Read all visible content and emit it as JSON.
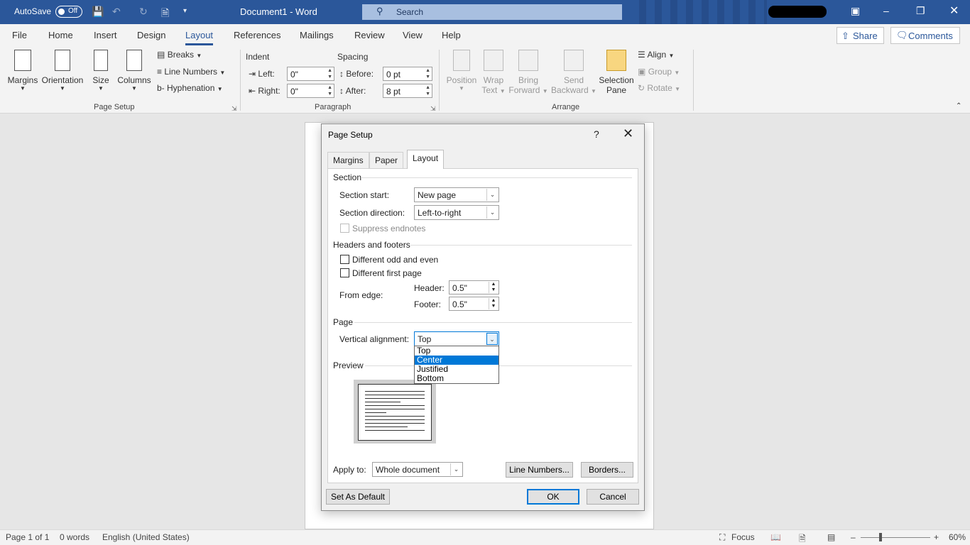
{
  "titlebar": {
    "autosave_label": "AutoSave",
    "autosave_state": "Off",
    "document_title": "Document1  -  Word",
    "search_placeholder": "Search",
    "save_icon": "save-icon",
    "undo_icon": "undo-icon",
    "redo_icon": "redo-icon"
  },
  "ribbon_tabs": {
    "file": "File",
    "home": "Home",
    "insert": "Insert",
    "design": "Design",
    "layout": "Layout",
    "references": "References",
    "mailings": "Mailings",
    "review": "Review",
    "view": "View",
    "help": "Help",
    "share": "Share",
    "comments": "Comments"
  },
  "ribbon": {
    "margins": "Margins",
    "orientation": "Orientation",
    "size": "Size",
    "columns": "Columns",
    "breaks": "Breaks",
    "line_numbers": "Line Numbers",
    "hyphenation": "Hyphenation",
    "page_setup_group": "Page Setup",
    "indent": "Indent",
    "spacing": "Spacing",
    "left_label": "Left:",
    "left_value": "0\"",
    "right_label": "Right:",
    "right_value": "0\"",
    "before_label": "Before:",
    "before_value": "0 pt",
    "after_label": "After:",
    "after_value": "8 pt",
    "paragraph_group": "Paragraph",
    "position_1": "Position",
    "wrap_1": "Wrap",
    "wrap_2": "Text",
    "bring_1": "Bring",
    "bring_2": "Forward",
    "send_1": "Send",
    "send_2": "Backward",
    "selection_1": "Selection",
    "selection_2": "Pane",
    "align": "Align",
    "group": "Group",
    "rotate": "Rotate",
    "arrange_group": "Arrange"
  },
  "dialog": {
    "title": "Page Setup",
    "help": "?",
    "tabs": [
      "Margins",
      "Paper",
      "Layout"
    ],
    "section_heading": "Section",
    "section_start_label": "Section start:",
    "section_start_value": "New page",
    "section_direction_label": "Section direction:",
    "section_direction_value": "Left-to-right",
    "suppress_endnotes": "Suppress endnotes",
    "headers_footers_heading": "Headers and footers",
    "different_odd_even": "Different odd and even",
    "different_first_page": "Different first page",
    "from_edge": "From edge:",
    "header_label": "Header:",
    "header_value": "0.5\"",
    "footer_label": "Footer:",
    "footer_value": "0.5\"",
    "page_heading": "Page",
    "vertical_alignment_label": "Vertical alignment:",
    "vertical_alignment_value": "Top",
    "vertical_alignment_options": [
      "Top",
      "Center",
      "Justified",
      "Bottom"
    ],
    "preview_heading": "Preview",
    "apply_to_label": "Apply to:",
    "apply_to_value": "Whole document",
    "line_numbers_button": "Line Numbers...",
    "borders_button": "Borders...",
    "set_default_button": "Set As Default",
    "ok_button": "OK",
    "cancel_button": "Cancel"
  },
  "statusbar": {
    "page": "Page 1 of 1",
    "words": "0 words",
    "language": "English (United States)",
    "focus": "Focus",
    "zoom": "60%"
  }
}
